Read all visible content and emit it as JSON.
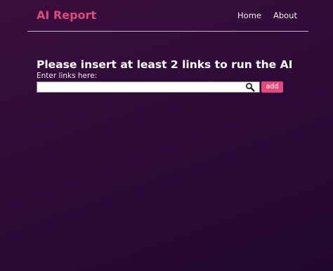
{
  "navbar": {
    "brand": "AI Report",
    "links": [
      {
        "label": "Home"
      },
      {
        "label": "About"
      }
    ]
  },
  "main": {
    "heading": "Please insert at least 2 links to run the AI",
    "input_label": "Enter links here:",
    "input_value": "",
    "input_placeholder": "",
    "add_label": "add"
  },
  "colors": {
    "accent": "#e2497b",
    "background": "#2e0b36",
    "text": "#ffffff"
  },
  "icons": {
    "search": "search-icon"
  }
}
